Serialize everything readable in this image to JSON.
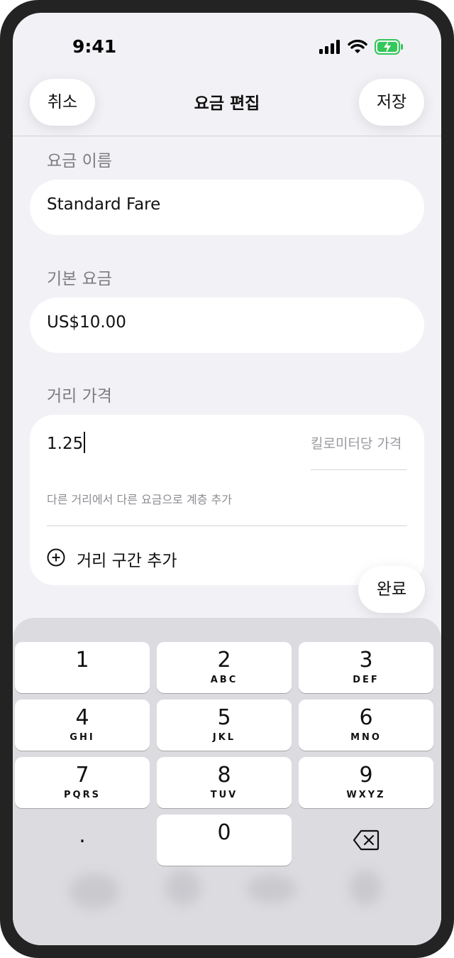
{
  "status_bar": {
    "time": "9:41"
  },
  "nav": {
    "cancel": "취소",
    "title": "요금 편집",
    "save": "저장"
  },
  "fare_name": {
    "label": "요금 이름",
    "value": "Standard Fare"
  },
  "base_fare": {
    "label": "기본 요금",
    "value": "US$10.00"
  },
  "distance_price": {
    "label": "거리 가격",
    "value": "1.25",
    "unit_label": "킬로미터당 가격",
    "hint": "다른 거리에서 다른 요금으로 계층 추가",
    "add_tier": "거리 구간 추가"
  },
  "done": "완료",
  "keypad": {
    "keys": [
      {
        "digit": "1",
        "letters": ""
      },
      {
        "digit": "2",
        "letters": "ABC"
      },
      {
        "digit": "3",
        "letters": "DEF"
      },
      {
        "digit": "4",
        "letters": "GHI"
      },
      {
        "digit": "5",
        "letters": "JKL"
      },
      {
        "digit": "6",
        "letters": "MNO"
      },
      {
        "digit": "7",
        "letters": "PQRS"
      },
      {
        "digit": "8",
        "letters": "TUV"
      },
      {
        "digit": "9",
        "letters": "WXYZ"
      },
      {
        "digit": "0",
        "letters": ""
      }
    ],
    "decimal": "."
  },
  "colors": {
    "background": "#f2f2f6",
    "battery_green": "#34c759",
    "keyboard": "#dcdce0"
  },
  "icons": [
    "cellular-signal-icon",
    "wifi-icon",
    "battery-charging-icon",
    "plus-circle-icon",
    "backspace-icon"
  ]
}
